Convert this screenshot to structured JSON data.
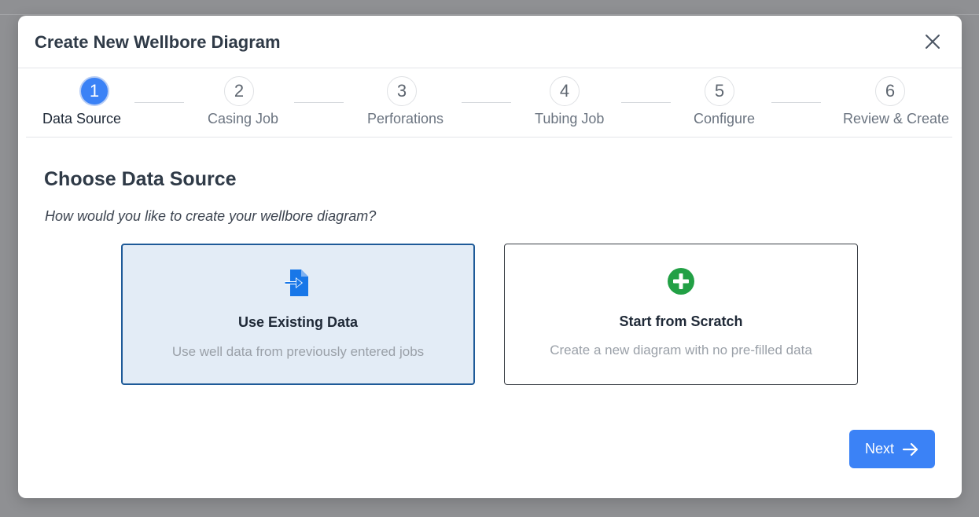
{
  "dialog": {
    "title": "Create New Wellbore Diagram",
    "close_icon": "close-icon"
  },
  "stepper": {
    "steps": [
      {
        "number": "1",
        "label": "Data Source",
        "active": true
      },
      {
        "number": "2",
        "label": "Casing Job",
        "active": false
      },
      {
        "number": "3",
        "label": "Perforations",
        "active": false
      },
      {
        "number": "4",
        "label": "Tubing Job",
        "active": false
      },
      {
        "number": "5",
        "label": "Configure",
        "active": false
      },
      {
        "number": "6",
        "label": "Review & Create",
        "active": false
      }
    ]
  },
  "content": {
    "title": "Choose Data Source",
    "subtitle": "How would you like to create your wellbore diagram?",
    "options": [
      {
        "title": "Use Existing Data",
        "description": "Use well data from previously entered jobs",
        "icon": "file-import-icon",
        "selected": true
      },
      {
        "title": "Start from Scratch",
        "description": "Create a new diagram with no pre-filled data",
        "icon": "plus-circle-icon",
        "selected": false
      }
    ]
  },
  "footer": {
    "next_label": "Next",
    "next_icon": "arrow-right-icon"
  },
  "colors": {
    "accent": "#3b82f6",
    "selected_border": "#1e5a98",
    "selected_bg": "#e3ecf6",
    "success": "#22a045",
    "file_icon": "#1877e8"
  }
}
